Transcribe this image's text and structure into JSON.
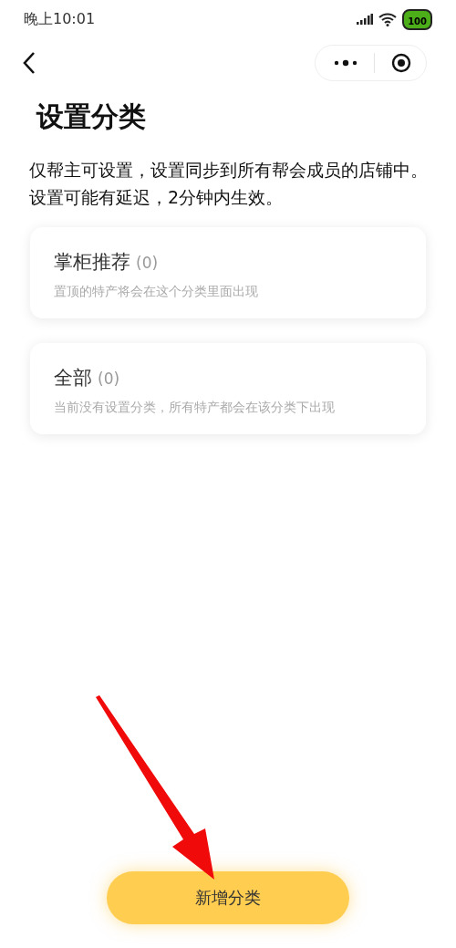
{
  "status_bar": {
    "time": "晚上10:01",
    "battery": "100"
  },
  "title": "设置分类",
  "description": "仅帮主可设置，设置同步到所有帮会成员的店铺中。设置可能有延迟，2分钟内生效。",
  "categories": [
    {
      "name": "掌柜推荐",
      "count": "(0)",
      "hint": "置顶的特产将会在这个分类里面出现"
    },
    {
      "name": "全部",
      "count": "(0)",
      "hint": "当前没有设置分类，所有特产都会在该分类下出现"
    }
  ],
  "add_button": "新增分类"
}
